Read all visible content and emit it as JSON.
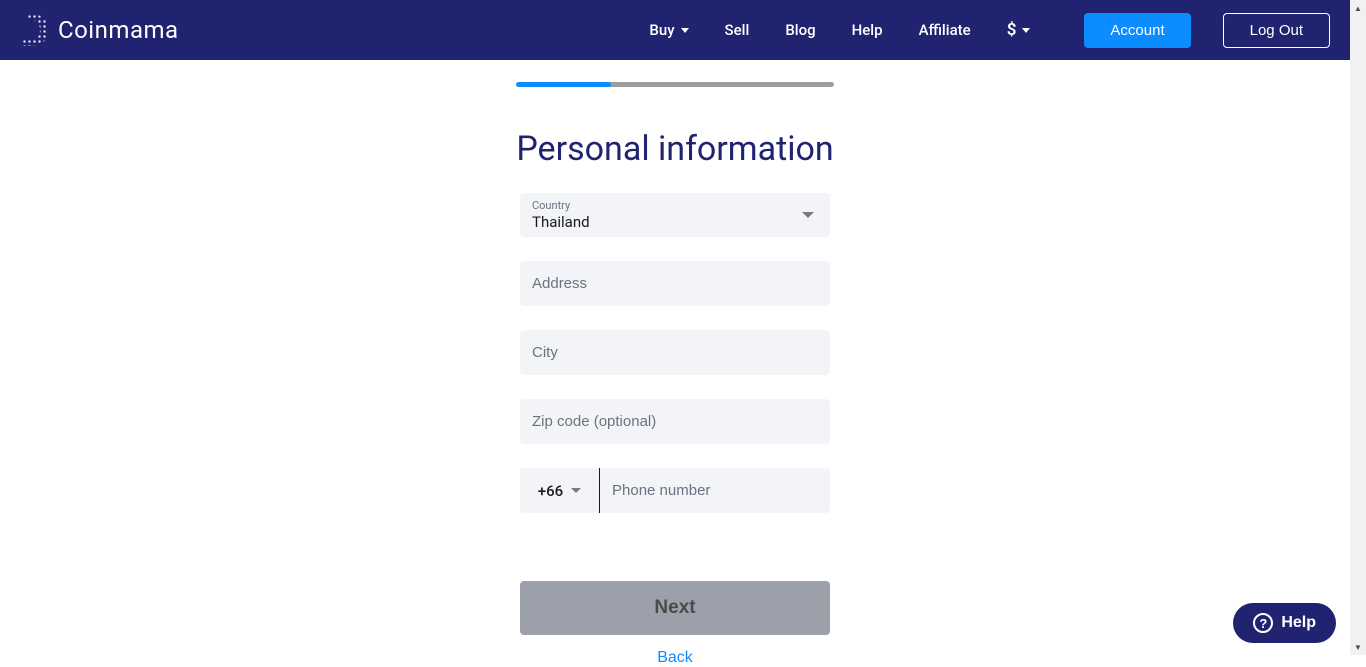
{
  "header": {
    "brand": "Coinmama",
    "nav": {
      "buy": "Buy",
      "sell": "Sell",
      "blog": "Blog",
      "help": "Help",
      "affiliate": "Affiliate",
      "currency": "$"
    },
    "account_label": "Account",
    "logout_label": "Log Out"
  },
  "main": {
    "title": "Personal information",
    "fields": {
      "country_label": "Country",
      "country_value": "Thailand",
      "address_placeholder": "Address",
      "city_placeholder": "City",
      "zip_placeholder": "Zip code (optional)",
      "phone_code": "+66",
      "phone_placeholder": "Phone number"
    },
    "next_label": "Next",
    "back_label": "Back"
  },
  "help_button": "Help"
}
